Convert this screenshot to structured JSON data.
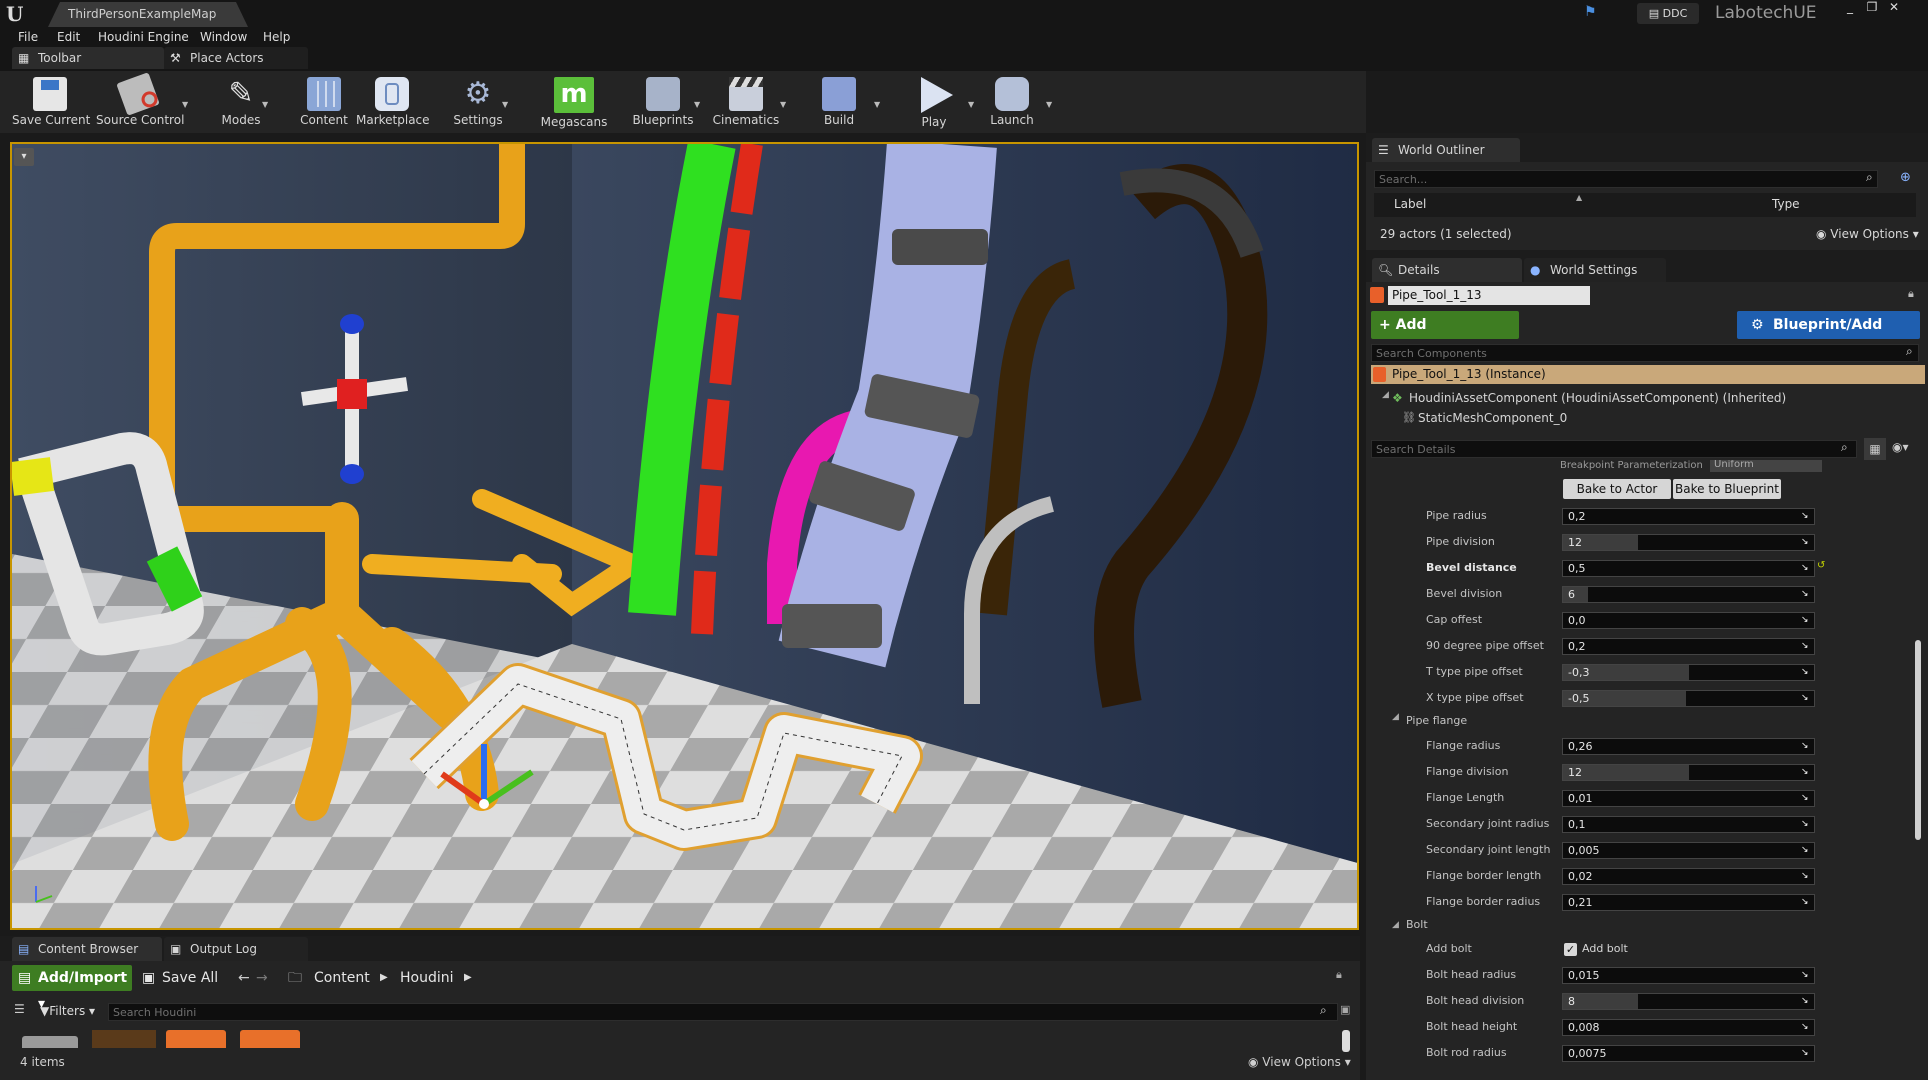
{
  "window": {
    "tab_title": "ThirdPersonExampleMap",
    "ddc_label": "DDC",
    "project_name": "LabotechUE"
  },
  "menu": [
    "File",
    "Edit",
    "Houdini Engine",
    "Window",
    "Help"
  ],
  "top_tabs": {
    "toolbar": "Toolbar",
    "place_actors": "Place Actors"
  },
  "toolbar": [
    {
      "label": "Save Current",
      "icon": "save-icon"
    },
    {
      "label": "Source Control",
      "icon": "source-control-icon"
    },
    {
      "label": "Modes",
      "icon": "modes-icon"
    },
    {
      "label": "Content",
      "icon": "content-icon"
    },
    {
      "label": "Marketplace",
      "icon": "marketplace-icon"
    },
    {
      "label": "Settings",
      "icon": "settings-icon"
    },
    {
      "label": "Megascans",
      "icon": "megascans-icon"
    },
    {
      "label": "Blueprints",
      "icon": "blueprints-icon"
    },
    {
      "label": "Cinematics",
      "icon": "cinematics-icon"
    },
    {
      "label": "Build",
      "icon": "build-icon"
    },
    {
      "label": "Play",
      "icon": "play-icon"
    },
    {
      "label": "Launch",
      "icon": "launch-icon"
    }
  ],
  "outliner": {
    "tab": "World Outliner",
    "search_placeholder": "Search...",
    "col_label": "Label",
    "col_type": "Type",
    "actor_count": "29 actors (1 selected)",
    "view_options": "View Options"
  },
  "details": {
    "tab": "Details",
    "world_settings_tab": "World Settings",
    "actor_name": "Pipe_Tool_1_13",
    "add_component": "+ Add Component",
    "blueprint_script": "Blueprint/Add Script",
    "search_components_placeholder": "Search Components",
    "instance_label": "Pipe_Tool_1_13 (Instance)",
    "component_1": "HoudiniAssetComponent (HoudiniAssetComponent) (Inherited)",
    "component_2": "StaticMeshComponent_0",
    "search_details_placeholder": "Search Details",
    "breakpoint_label": "Breakpoint Parameterization",
    "breakpoint_value": "Uniform",
    "bake_actor": "Bake to Actor",
    "bake_blueprint": "Bake to Blueprint",
    "pipe_props": [
      {
        "label": "Pipe radius",
        "value": "0,2",
        "fill": 0
      },
      {
        "label": "Pipe division",
        "value": "12",
        "fill": 0.3
      },
      {
        "label": "Bevel distance",
        "value": "0,5",
        "fill": 0
      },
      {
        "label": "Bevel division",
        "value": "6",
        "fill": 0.1
      },
      {
        "label": "Cap offest",
        "value": "0,0",
        "fill": 0
      },
      {
        "label": "90 degree pipe offset",
        "value": "0,2",
        "fill": 0
      },
      {
        "label": "T type pipe offset",
        "value": "-0,3",
        "fill": 0.5
      },
      {
        "label": "X type pipe offset",
        "value": "-0,5",
        "fill": 0.49
      }
    ],
    "flange_section": "Pipe flange",
    "flange_props": [
      {
        "label": "Flange radius",
        "value": "0,26",
        "fill": 0
      },
      {
        "label": "Flange division",
        "value": "12",
        "fill": 0.5
      },
      {
        "label": "Flange Length",
        "value": "0,01",
        "fill": 0
      },
      {
        "label": "Secondary joint radius",
        "value": "0,1",
        "fill": 0
      },
      {
        "label": "Secondary joint length",
        "value": "0,005",
        "fill": 0
      },
      {
        "label": "Flange border length",
        "value": "0,02",
        "fill": 0
      },
      {
        "label": "Flange border radius",
        "value": "0,21",
        "fill": 0
      }
    ],
    "bolt_section": "Bolt",
    "add_bolt_label": "Add bolt",
    "add_bolt_checkbox": "Add bolt",
    "bolt_props": [
      {
        "label": "Bolt head radius",
        "value": "0,015",
        "fill": 0
      },
      {
        "label": "Bolt head division",
        "value": "8",
        "fill": 0.3
      },
      {
        "label": "Bolt head height",
        "value": "0,008",
        "fill": 0
      },
      {
        "label": "Bolt rod radius",
        "value": "0,0075",
        "fill": 0
      }
    ]
  },
  "content_browser": {
    "tab": "Content Browser",
    "output_log_tab": "Output Log",
    "add_import": "Add/Import",
    "save_all": "Save All",
    "path_root": "Content",
    "path_folder": "Houdini",
    "filters": "Filters",
    "search_placeholder": "Search Houdini",
    "item_count": "4 items",
    "view_options": "View Options"
  },
  "colors": {
    "accent_orange": "#c79500",
    "add_green": "#3e7d22",
    "blueprint_blue": "#1f5fb0",
    "selection_row": "#c9a87a"
  }
}
